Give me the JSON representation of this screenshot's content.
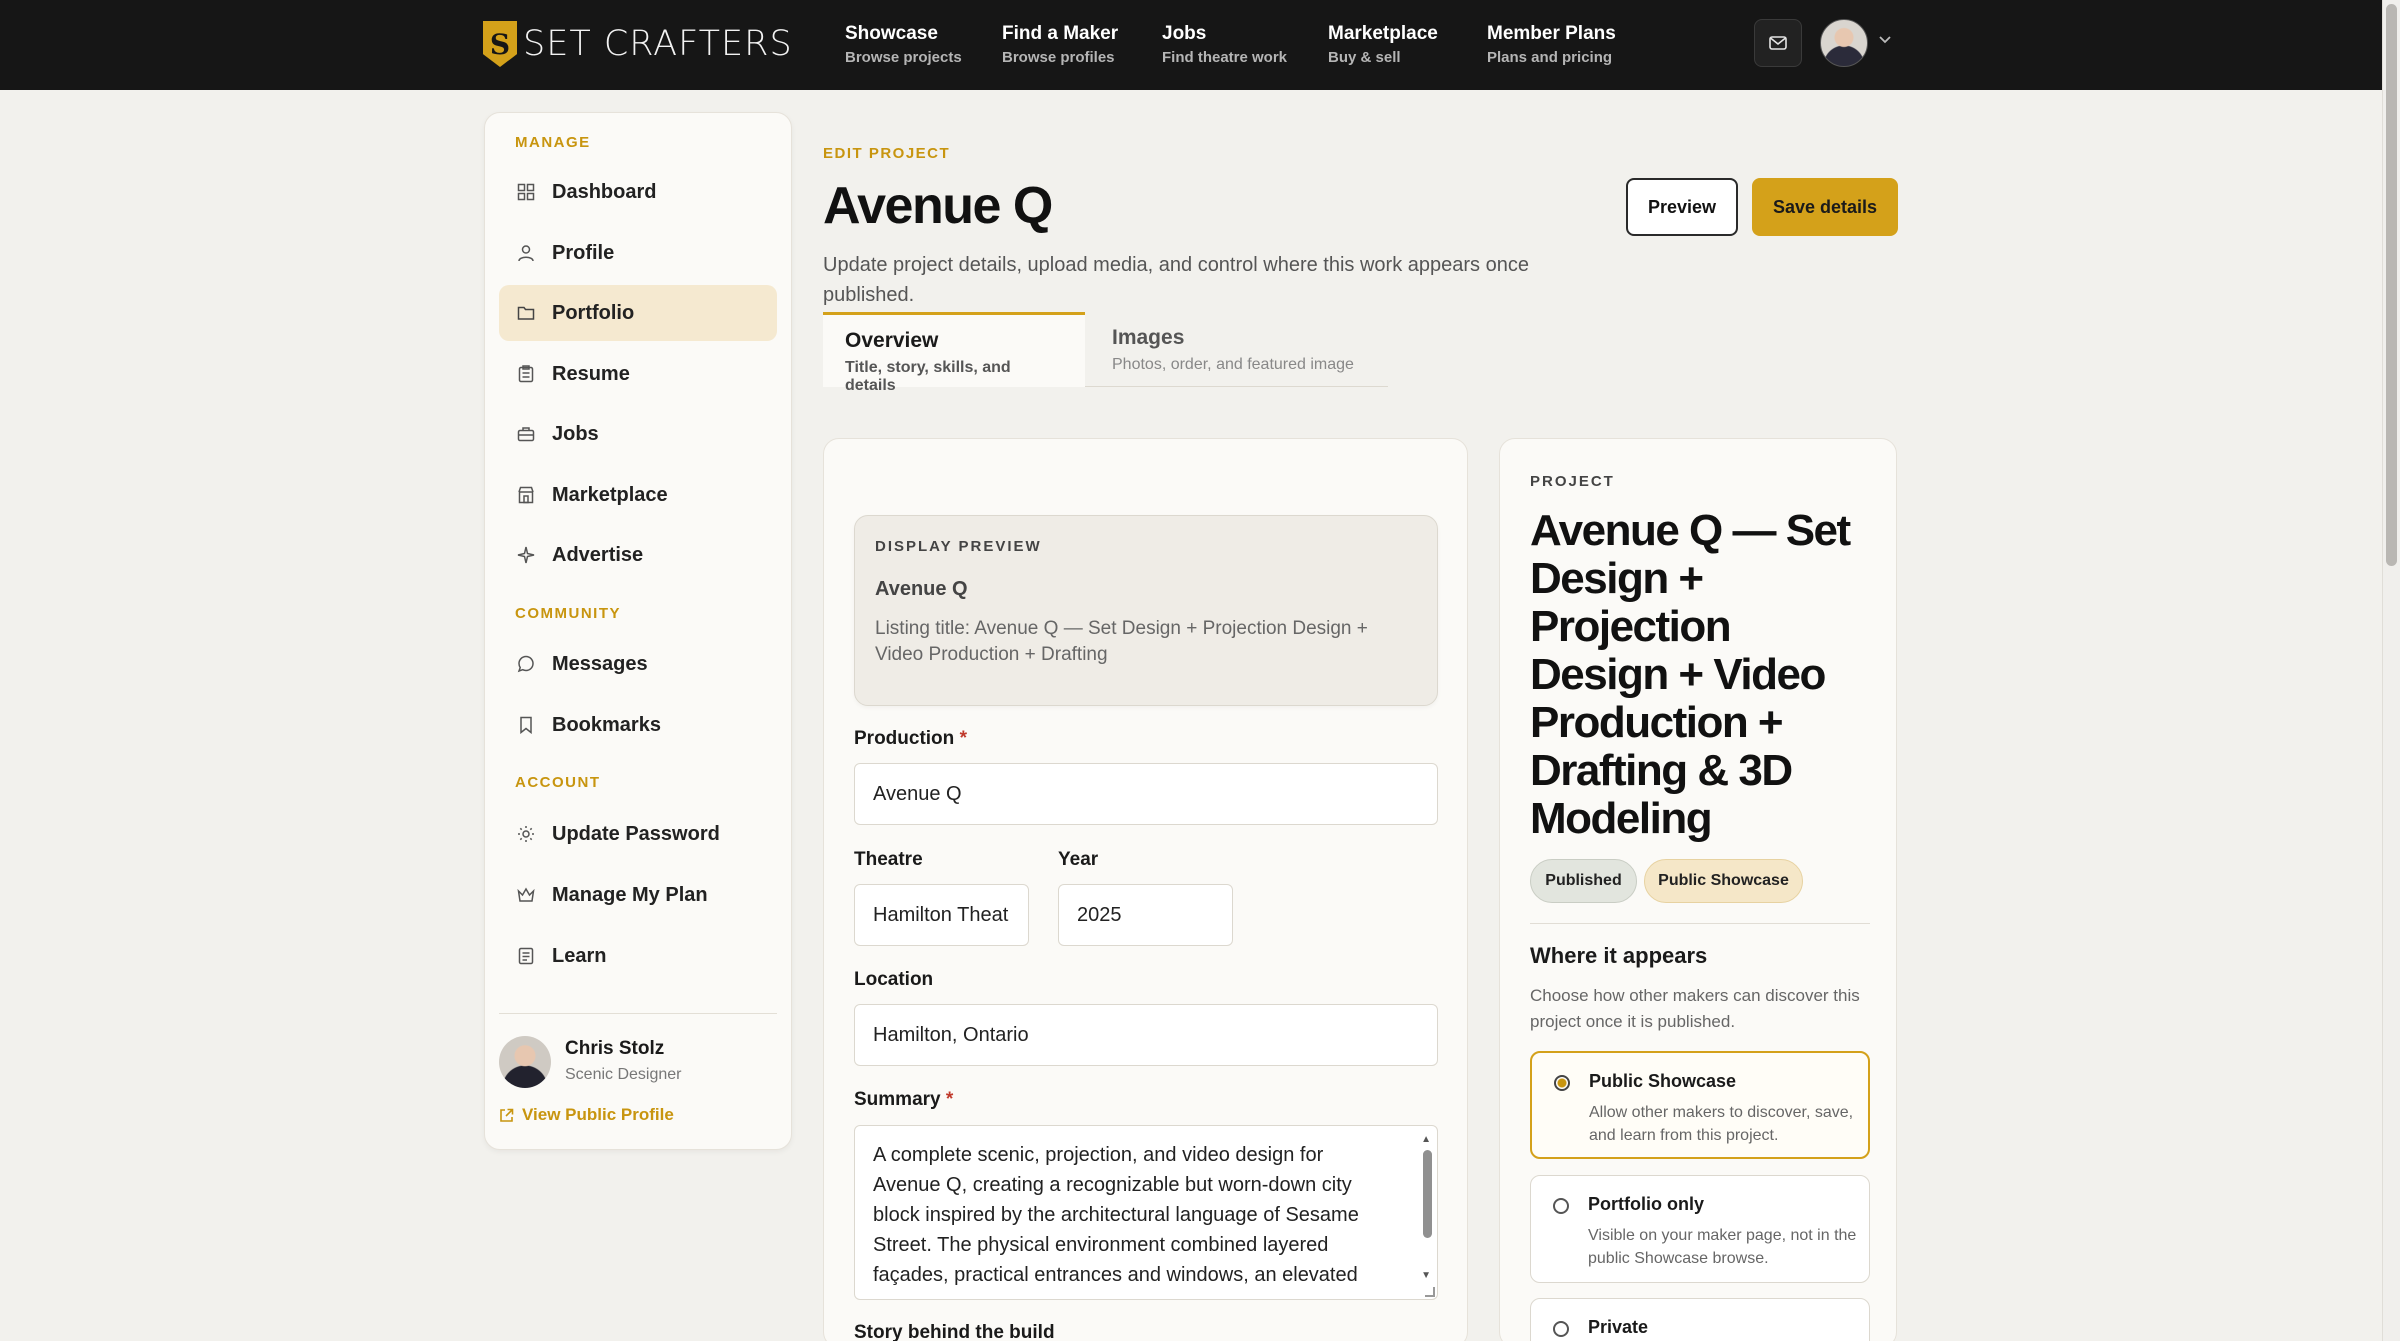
{
  "brand": {
    "logo_letter": "S",
    "name": "SET CRAFTERS",
    "accent": "#d4a11a",
    "nav_bg": "#161616"
  },
  "nav": [
    {
      "title": "Showcase",
      "sub": "Browse projects"
    },
    {
      "title": "Find a Maker",
      "sub": "Browse profiles"
    },
    {
      "title": "Jobs",
      "sub": "Find theatre work"
    },
    {
      "title": "Marketplace",
      "sub": "Buy & sell"
    },
    {
      "title": "Member Plans",
      "sub": "Plans and pricing"
    }
  ],
  "top_icons": {
    "mail": "mail-icon",
    "avatar": "user-avatar",
    "menu": "chevron-down-icon"
  },
  "sidebar": {
    "manage_label": "MANAGE",
    "community_label": "COMMUNITY",
    "account_label": "ACCOUNT",
    "items": [
      {
        "label": "Dashboard",
        "icon": "grid-icon"
      },
      {
        "label": "Profile",
        "icon": "user-icon"
      },
      {
        "label": "Portfolio",
        "icon": "folder-icon",
        "active": true
      },
      {
        "label": "Resume",
        "icon": "clipboard-icon"
      },
      {
        "label": "Jobs",
        "icon": "briefcase-icon"
      },
      {
        "label": "Marketplace",
        "icon": "store-icon"
      },
      {
        "label": "Advertise",
        "icon": "sparkle-icon"
      },
      {
        "label": "Messages",
        "icon": "chat-icon"
      },
      {
        "label": "Bookmarks",
        "icon": "bookmark-icon"
      },
      {
        "label": "Update Password",
        "icon": "gear-icon"
      },
      {
        "label": "Manage My Plan",
        "icon": "crown-icon"
      },
      {
        "label": "Learn",
        "icon": "book-icon"
      }
    ],
    "user": {
      "name": "Chris Stolz",
      "role": "Scenic Designer",
      "link": "View Public Profile"
    }
  },
  "header": {
    "eyebrow": "EDIT PROJECT",
    "title": "Avenue Q",
    "description": "Update project details, upload media, and control where this work appears once published.",
    "preview_label": "Preview",
    "save_label": "Save details"
  },
  "tabs": [
    {
      "title": "Overview",
      "sub": "Title, story, skills, and details",
      "active": true
    },
    {
      "title": "Images",
      "sub": "Photos, order, and featured image"
    }
  ],
  "form": {
    "preview_eyebrow": "DISPLAY PREVIEW",
    "preview_title": "Avenue Q",
    "preview_listing": "Listing title: Avenue Q — Set Design + Projection Design + Video Production + Drafting",
    "production_label": "Production",
    "production_value": "Avenue Q",
    "required_mark": "*",
    "theatre_label": "Theatre",
    "theatre_value": "Hamilton Theat",
    "year_label": "Year",
    "year_value": "2025",
    "location_label": "Location",
    "location_value": "Hamilton, Ontario",
    "summary_label": "Summary",
    "summary_value": "A complete scenic, projection, and video design for Avenue Q, creating a recognizable but worn-down city block inspired by the architectural language of Sesame Street. The physical environment combined layered façades, practical entrances and windows, an elevated",
    "story_label": "Story behind the build"
  },
  "project": {
    "eyebrow": "PROJECT",
    "title": "Avenue Q — Set Design + Projection Design + Video Production + Drafting & 3D Modeling",
    "badge_published": "Published",
    "badge_showcase": "Public Showcase",
    "where_title": "Where it appears",
    "where_desc": "Choose how other makers can discover this project once it is published.",
    "options": [
      {
        "title": "Public Showcase",
        "desc": "Allow other makers to discover, save, and learn from this project.",
        "selected": true
      },
      {
        "title": "Portfolio only",
        "desc": "Visible on your maker page, not in the public Showcase browse."
      },
      {
        "title": "Private",
        "desc": ""
      }
    ]
  }
}
